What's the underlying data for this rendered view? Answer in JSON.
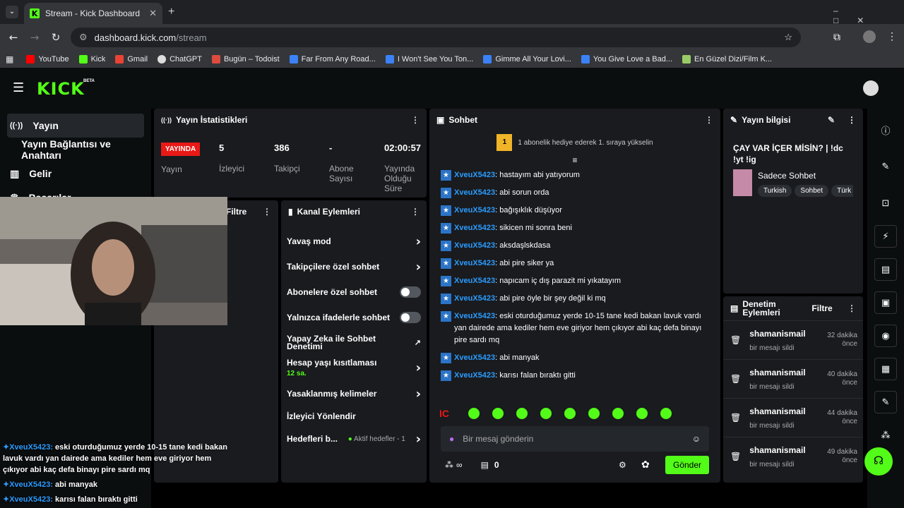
{
  "browser": {
    "tab_title": "Stream - Kick Dashboard",
    "url_host": "dashboard.kick.com",
    "url_path": "/stream",
    "bookmarks": [
      "YouTube",
      "Kick",
      "Gmail",
      "ChatGPT",
      "Bugün – Todoist",
      "Far From Any Road...",
      "I Won't See You Ton...",
      "Gimme All Your Lovi...",
      "You Give Love a Bad...",
      "En Güzel Dizi/Film K..."
    ]
  },
  "logo": "KICK",
  "logo_badge": "BETA",
  "sidebar": {
    "items": [
      "Yayın",
      "Yayın Bağlantısı ve Anahtarı",
      "Gelir",
      "Başarılar"
    ]
  },
  "stats": {
    "title": "Yayın İstatistikleri",
    "live_badge": "YAYINDA",
    "status_label": "Yayın",
    "viewers_value": "5",
    "viewers_label": "İzleyici",
    "followers_value": "386",
    "followers_label": "Takipçi",
    "subs_value": "-",
    "subs_label": "Abone Sayısı",
    "time_value": "02:00:57",
    "time_label": "Yayında Olduğu Süre"
  },
  "filter_label": "Filtre",
  "actions": {
    "title": "Kanal Eylemleri",
    "slow_mode": "Yavaş mod",
    "followers_only": "Takipçilere özel sohbet",
    "subs_only": "Abonelere özel sohbet",
    "emotes_only": "Yalnızca ifadelerle sohbet",
    "ai": "Yapay Zeka ile Sohbet Denetimi",
    "age": "Hesap yaşı kısıtlaması",
    "age_sub": "12 sa.",
    "banned": "Yasaklanmış kelimeler",
    "redirect": "İzleyici Yönlendir",
    "goals": "Hedefleri b...",
    "goals_status": "Aktif hedefler - 1"
  },
  "chat": {
    "title": "Sohbet",
    "gift_rank": "1",
    "gift_text": "1 abonelik hediye ederek 1. sıraya yükselin",
    "messages": [
      {
        "user": "XveuX5423",
        "text": "hastayım abi yatıyorum"
      },
      {
        "user": "XveuX5423",
        "text": "abi sorun orda"
      },
      {
        "user": "XveuX5423",
        "text": "bağışıklık düşüyor"
      },
      {
        "user": "XveuX5423",
        "text": "sikicen mi sonra beni"
      },
      {
        "user": "XveuX5423",
        "text": "aksdaşlskdasa"
      },
      {
        "user": "XveuX5423",
        "text": "abi pire siker ya"
      },
      {
        "user": "XveuX5423",
        "text": "napıcam iç dış parazit mi yıkatayım"
      },
      {
        "user": "XveuX5423",
        "text": "abi pire öyle bir şey değil ki mq"
      },
      {
        "user": "XveuX5423",
        "text": "eski oturduğumuz yerde 10-15 tane kedi bakan lavuk vardı yan dairede ama kediler hem eve giriyor hem çıkıyor abi kaç defa binayı pire sardı mq"
      },
      {
        "user": "XveuX5423",
        "text": "abi manyak"
      },
      {
        "user": "XveuX5423",
        "text": "karısı falan bıraktı gitti"
      }
    ],
    "input_placeholder": "Bir mesaj gönderin",
    "points": "∞",
    "count": "0",
    "send": "Gönder",
    "ic_emote": "IC"
  },
  "info": {
    "title": "Yayın bilgisi",
    "stream_title": "ÇAY VAR İÇER MİSİN? | !dc !yt !ig",
    "category": "Sadece Sohbet",
    "tags": [
      "Turkish",
      "Sohbet",
      "Türk"
    ]
  },
  "mod": {
    "title": "Denetim Eylemleri",
    "filter": "Filtre",
    "rows": [
      {
        "user": "shamanismail",
        "action": "bir mesajı sildi",
        "time": "32 dakika önce"
      },
      {
        "user": "shamanismail",
        "action": "bir mesajı sildi",
        "time": "40 dakika önce"
      },
      {
        "user": "shamanismail",
        "action": "bir mesajı sildi",
        "time": "44 dakika önce"
      },
      {
        "user": "shamanismail",
        "action": "bir mesajı sildi",
        "time": "49 dakika önce"
      }
    ]
  },
  "overlay": [
    {
      "user": "XveuX5423",
      "text": "eski oturduğumuz yerde 10-15 tane kedi bakan lavuk vardı yan dairede ama kediler hem eve giriyor hem çıkıyor abi kaç defa binayı pire sardı mq"
    },
    {
      "user": "XveuX5423",
      "text": "abi manyak"
    },
    {
      "user": "XveuX5423",
      "text": "karısı falan bıraktı gitti"
    }
  ],
  "colors": {
    "accent": "#53fc18",
    "live": "#e91916",
    "username": "#2b9cff"
  }
}
